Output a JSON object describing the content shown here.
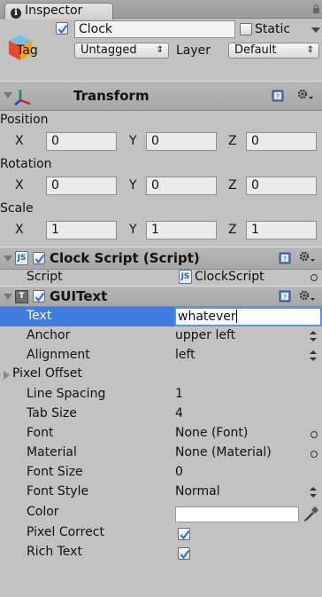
{
  "tab": {
    "label": "Inspector"
  },
  "header": {
    "object_name": "Clock",
    "static_label": "Static",
    "tag_label": "Tag",
    "tag_value": "Untagged",
    "layer_label": "Layer",
    "layer_value": "Default",
    "active": true,
    "static": false
  },
  "transform": {
    "title": "Transform",
    "position_label": "Position",
    "rotation_label": "Rotation",
    "scale_label": "Scale",
    "axis_x": "X",
    "axis_y": "Y",
    "axis_z": "Z",
    "position": {
      "x": "0",
      "y": "0",
      "z": "0"
    },
    "rotation": {
      "x": "0",
      "y": "0",
      "z": "0"
    },
    "scale": {
      "x": "1",
      "y": "1",
      "z": "1"
    }
  },
  "clock_script": {
    "title": "Clock Script (Script)",
    "script_label": "Script",
    "script_value": "ClockScript",
    "js_icon_text": "JS",
    "enabled": true
  },
  "guitext": {
    "title": "GUIText",
    "icon_text": "T",
    "enabled": true,
    "rows": {
      "text_label": "Text",
      "text_value": "whatever",
      "anchor_label": "Anchor",
      "anchor_value": "upper left",
      "alignment_label": "Alignment",
      "alignment_value": "left",
      "pixel_offset_label": "Pixel Offset",
      "line_spacing_label": "Line Spacing",
      "line_spacing_value": "1",
      "tab_size_label": "Tab Size",
      "tab_size_value": "4",
      "font_label": "Font",
      "font_value": "None (Font)",
      "material_label": "Material",
      "material_value": "None (Material)",
      "font_size_label": "Font Size",
      "font_size_value": "0",
      "font_style_label": "Font Style",
      "font_style_value": "Normal",
      "color_label": "Color",
      "color_value": "#ffffff",
      "pixel_correct_label": "Pixel Correct",
      "pixel_correct": true,
      "rich_text_label": "Rich Text",
      "rich_text": true
    }
  },
  "colors": {
    "selection": "#3e7ce0",
    "panel": "#c2c2c2",
    "header": "#ababab"
  }
}
